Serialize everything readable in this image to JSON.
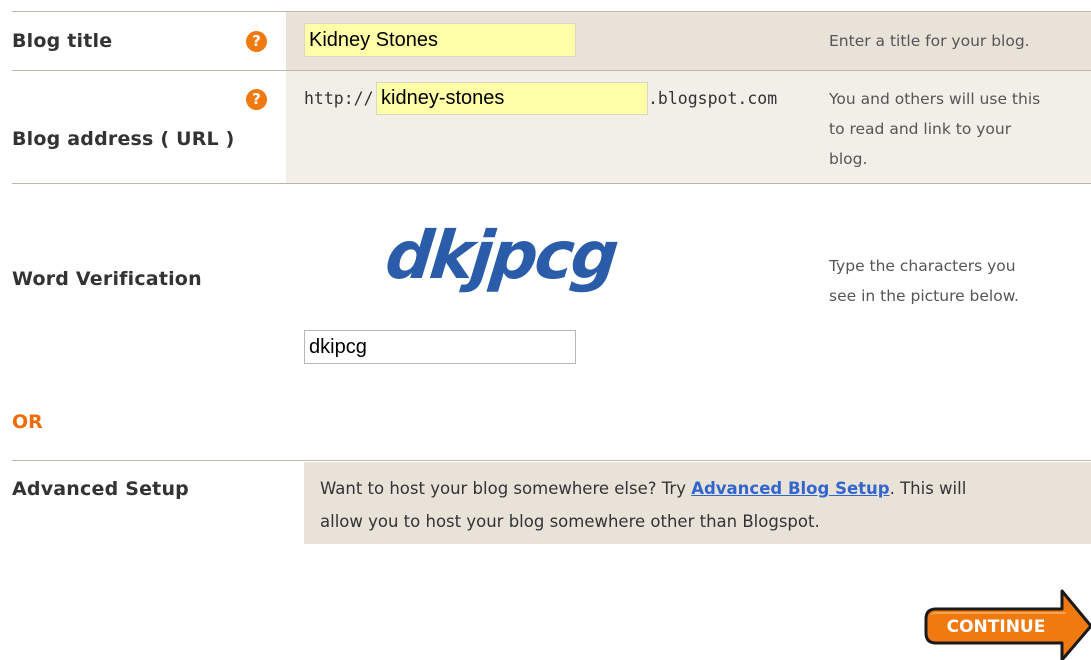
{
  "blog_title": {
    "label": "Blog title",
    "value": "Kidney Stones",
    "hint": "Enter a title for your blog."
  },
  "blog_address": {
    "label": "Blog address ( URL )",
    "prefix": "http://",
    "value": "kidney-stones",
    "suffix": ".blogspot.com",
    "hint_lines": [
      "You and others will use this",
      "to read and link to your",
      "blog."
    ]
  },
  "word_verification": {
    "label": "Word Verification",
    "captcha_text": "dkjpcg",
    "value": "dkipcg",
    "hint_lines": [
      "Type the characters you",
      "see in the picture below."
    ]
  },
  "or_label": "OR",
  "advanced": {
    "label": "Advanced Setup",
    "text_before": "Want to host your blog somewhere else? Try ",
    "link_text": "Advanced Blog Setup",
    "text_after": ". This will",
    "text_line2": "allow you to host your blog somewhere other than Blogspot."
  },
  "help_icon_glyph": "?",
  "continue_label": "CONTINUE",
  "colors": {
    "accent_orange": "#f07a10",
    "field_yellow": "#ffffa8",
    "shade": "#e8e2d9",
    "link_blue": "#3366cc",
    "captcha_blue": "#2a5caa"
  }
}
